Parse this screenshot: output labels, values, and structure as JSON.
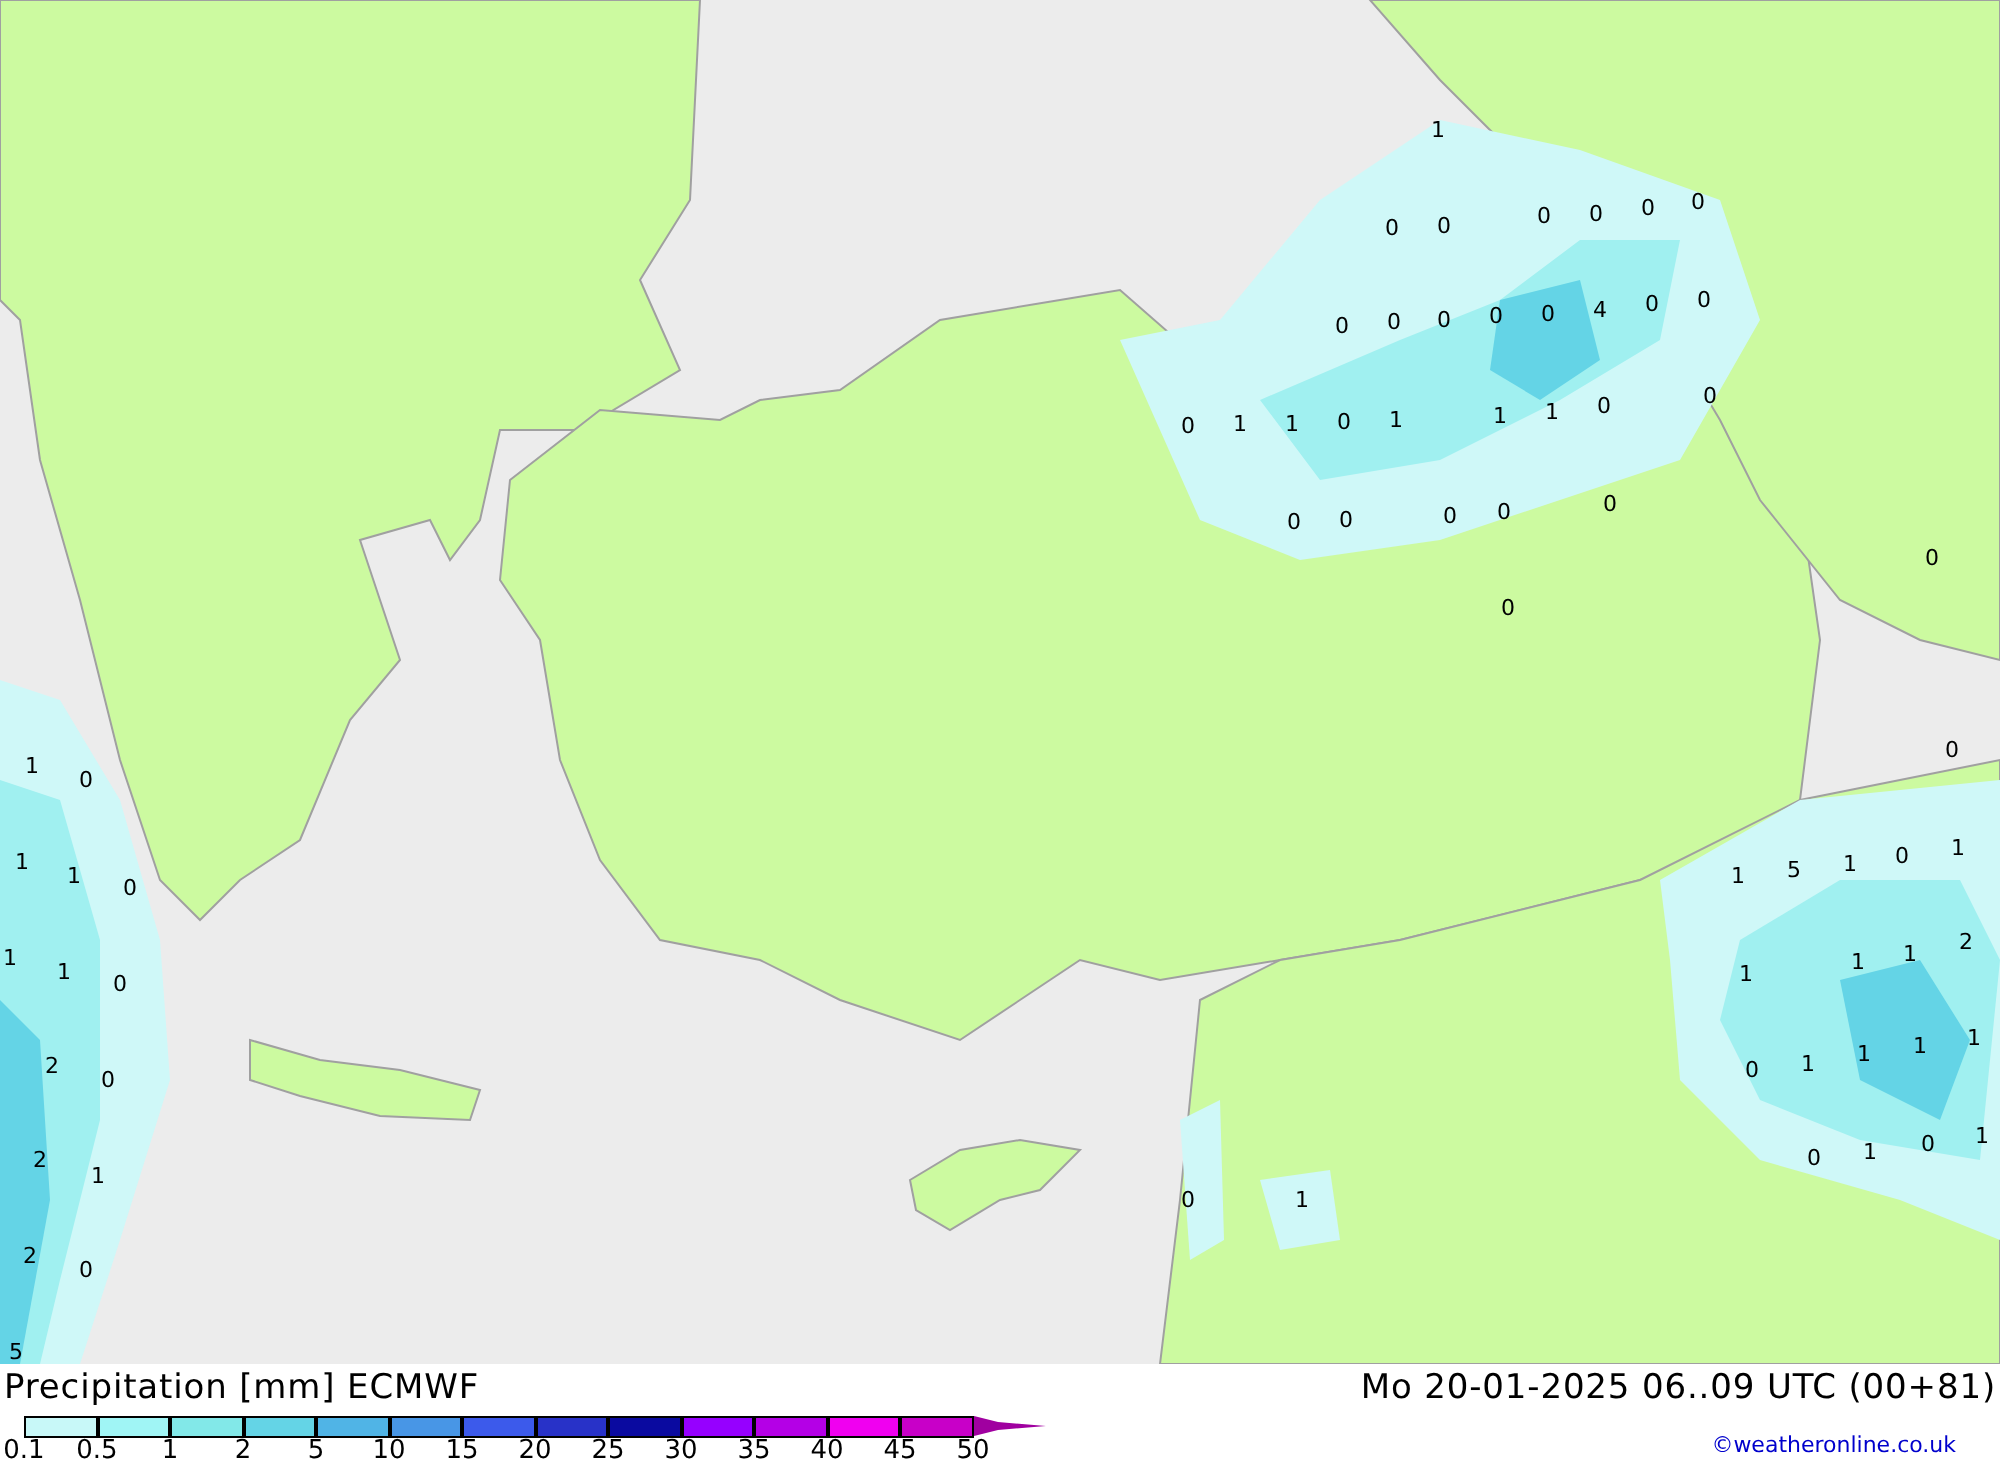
{
  "map": {
    "labels": [
      "1",
      "0",
      "0",
      "0",
      "0",
      "0",
      "0",
      "0",
      "0",
      "0",
      "0",
      "0",
      "4",
      "0",
      "0",
      "0",
      "0",
      "1",
      "1",
      "0",
      "1",
      "1",
      "1",
      "0",
      "0",
      "0",
      "0",
      "0",
      "0",
      "0",
      "0",
      "1",
      "0",
      "1",
      "1",
      "0",
      "0",
      "1",
      "1",
      "0",
      "1",
      "5",
      "1",
      "0",
      "1",
      "1",
      "2",
      "1",
      "1",
      "2",
      "0",
      "0",
      "1",
      "1",
      "1",
      "1",
      "2",
      "1",
      "0",
      "1",
      "0",
      "1",
      "0",
      "1",
      "2",
      "0",
      "5"
    ]
  },
  "footer": {
    "title": "Precipitation [mm] ECMWF",
    "datetime": "Mo 20-01-2025 06..09 UTC (00+81)",
    "credit": "©weatheronline.co.uk",
    "legend": [
      {
        "label": "0.1",
        "color": "#c8f8f8"
      },
      {
        "label": "0.5",
        "color": "#a0f5f5"
      },
      {
        "label": "1",
        "color": "#82e8e8"
      },
      {
        "label": "2",
        "color": "#64d4e6"
      },
      {
        "label": "5",
        "color": "#50b4e6"
      },
      {
        "label": "10",
        "color": "#4896e6"
      },
      {
        "label": "15",
        "color": "#3c5aeb"
      },
      {
        "label": "20",
        "color": "#2832c8"
      },
      {
        "label": "25",
        "color": "#0a0aa0"
      },
      {
        "label": "30",
        "color": "#9600ff"
      },
      {
        "label": "35",
        "color": "#b400e6"
      },
      {
        "label": "40",
        "color": "#f000f0"
      },
      {
        "label": "45",
        "color": "#c800c8"
      }
    ],
    "last_label": "50",
    "arrow": {
      "color": "#a000a0"
    }
  }
}
